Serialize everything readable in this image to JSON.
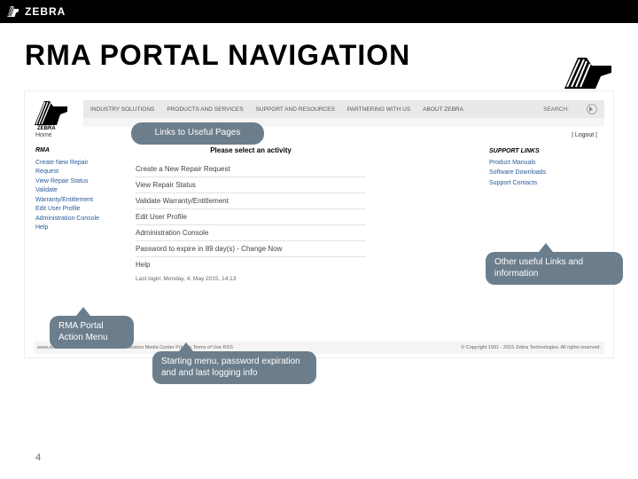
{
  "brand": {
    "name": "ZEBRA"
  },
  "slide": {
    "title": "RMA PORTAL NAVIGATION",
    "page_number": "4"
  },
  "callouts": {
    "useful_links": "Links to Useful Pages",
    "other_links": "Other useful Links and information",
    "action_menu": "RMA Portal Action Menu",
    "starting_menu": "Starting menu, password expiration and  and  last logging info"
  },
  "portal": {
    "nav": {
      "items": [
        "INDUSTRY SOLUTIONS",
        "PRODUCTS AND SERVICES",
        "SUPPORT AND RESOURCES",
        "PARTNERING WITH US",
        "ABOUT ZEBRA"
      ],
      "search_label": "SEARCH:"
    },
    "home_label": "Home",
    "logout_label": "| Logout |",
    "rma_menu": {
      "header": "RMA",
      "items": [
        "Create New Repair Request",
        "View Repair Status",
        "Validate Warranty/Entitlement",
        "Edit User Profile",
        "Administration Console",
        "Help"
      ]
    },
    "activity": {
      "title": "Please select an activity",
      "items": [
        "Create a New Repair Request",
        "View Repair Status",
        "Validate Warranty/Entitlement",
        "Edit User Profile",
        "Administration Console",
        "Password to expire in 89 day(s) - Change Now",
        "Help"
      ],
      "last_login": "Last login: Monday, 4. May 2015, 14:13"
    },
    "support": {
      "header": "SUPPORT LINKS",
      "items": [
        "Product Manuals",
        "Software Downloads",
        "Support Contacts"
      ]
    },
    "footer": {
      "left": "www.zebra.com   Careers   Contact Zebra   Investors   Media Center   Privacy   Terms of Use   RSS",
      "right": "© Copyright 1991 - 2015 Zebra Technologies. All rights reserved."
    }
  }
}
